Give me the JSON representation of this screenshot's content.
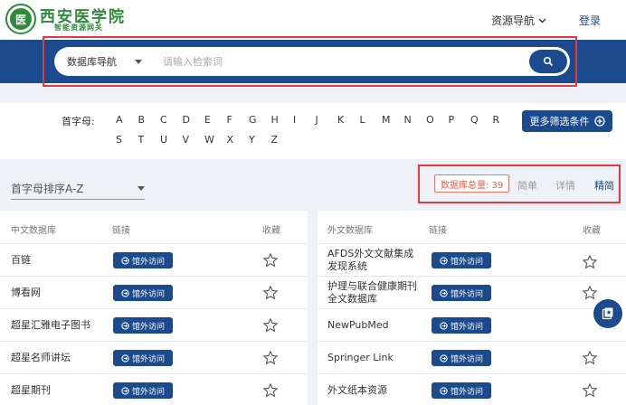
{
  "header": {
    "brand_name": "西安医学院",
    "brand_sub": "智能资源网关",
    "logo_char": "医",
    "nav_resources": "资源导航",
    "nav_login": "登录"
  },
  "search": {
    "selected": "数据库导航",
    "placeholder": "请输入检索词"
  },
  "letters": {
    "label": "首字母:",
    "row1": [
      "A",
      "B",
      "C",
      "D",
      "E",
      "F",
      "G",
      "H",
      "I",
      "J",
      "K",
      "L",
      "M",
      "N",
      "O",
      "P",
      "Q",
      "R"
    ],
    "row2": [
      "S",
      "T",
      "U",
      "V",
      "W",
      "X",
      "Y",
      "Z"
    ],
    "more_button": "更多筛选条件"
  },
  "sort": {
    "label": "首字母排序A-Z"
  },
  "view": {
    "total": "数据库总量: 39",
    "options": [
      "简单",
      "详情",
      "精简"
    ],
    "active": "精简"
  },
  "left_table": {
    "headers": [
      "中文数据库",
      "链接",
      "收藏"
    ],
    "rows": [
      "百链",
      "博看网",
      "超星汇雅电子图书",
      "超星名师讲坛",
      "超星期刊"
    ]
  },
  "right_table": {
    "headers": [
      "外文数据库",
      "链接",
      "收藏"
    ],
    "rows": [
      [
        "AFDS外文文献集成",
        "发现系统"
      ],
      [
        "护理与联合健康期刊",
        "全文数据库"
      ],
      [
        "NewPubMed",
        ""
      ],
      [
        "Springer Link",
        ""
      ],
      [
        "外文纸本资源",
        ""
      ]
    ]
  },
  "visit_label": "馆外访问",
  "colors": {
    "primary": "#1b4a8e",
    "brand_green": "#2e8b3a",
    "highlight": "#e23a3a"
  }
}
